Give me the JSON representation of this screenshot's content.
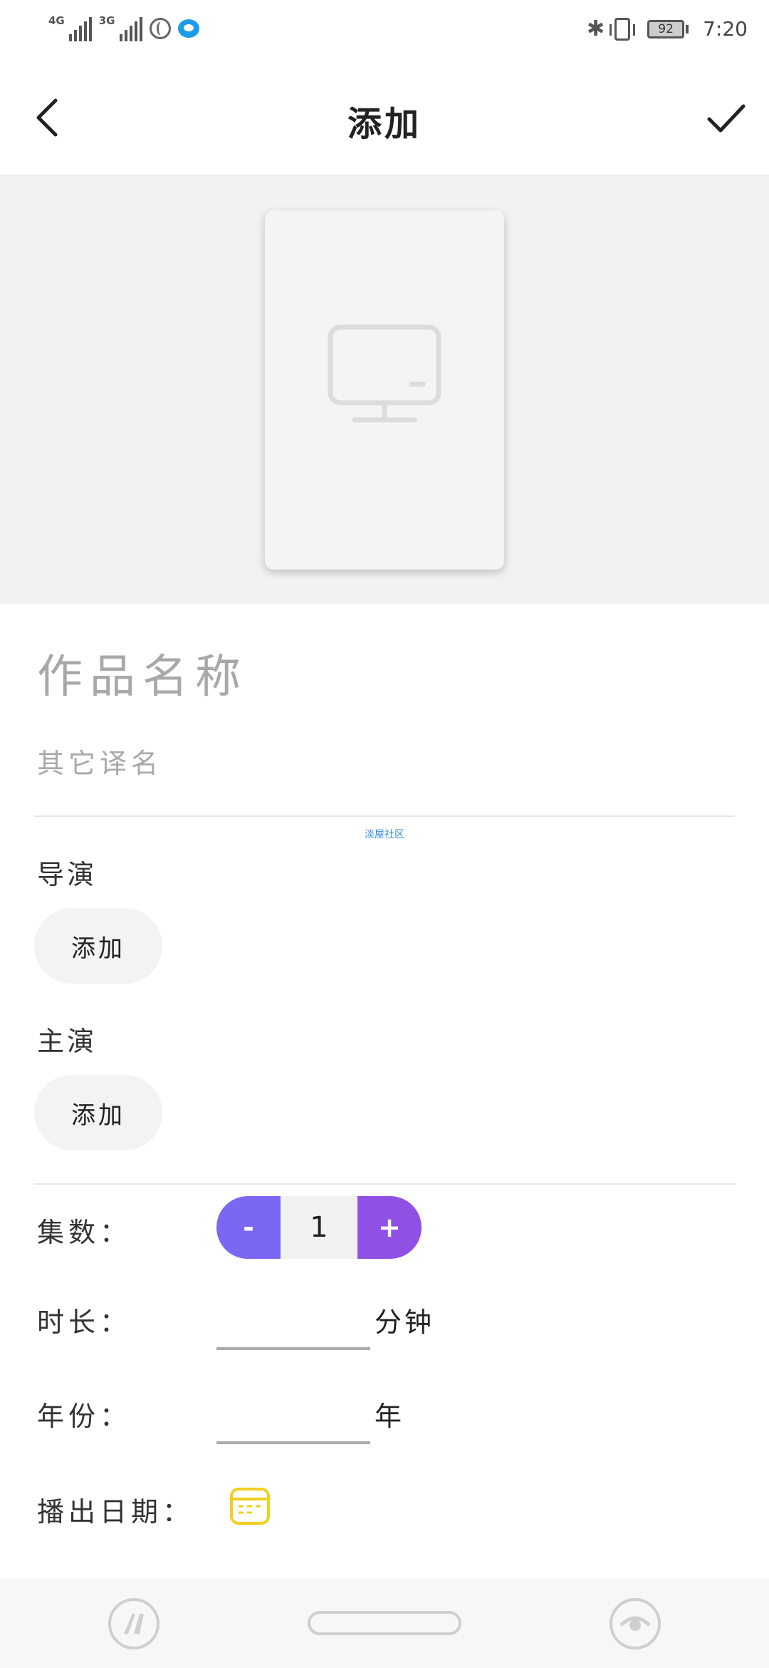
{
  "status_bar": {
    "net1": "4G",
    "net2": "3G",
    "battery": "92",
    "time": "7:20"
  },
  "header": {
    "title": "添加"
  },
  "form": {
    "work_name_placeholder": "作品名称",
    "other_name_placeholder": "其它译名",
    "watermark": "淡屋社区",
    "director_label": "导演",
    "director_add": "添加",
    "cast_label": "主演",
    "cast_add": "添加",
    "episodes_label": "集数：",
    "episodes_minus": "-",
    "episodes_value": "1",
    "episodes_plus": "+",
    "duration_label": "时长：",
    "duration_unit": "分钟",
    "year_label": "年份：",
    "year_unit": "年",
    "air_date_label": "播出日期："
  },
  "icons": {
    "back": "chevron-left-icon",
    "confirm": "checkmark-icon",
    "cover": "monitor-icon",
    "calendar": "calendar-icon"
  },
  "colors": {
    "stepper_minus": "#7a68f2",
    "stepper_plus": "#9150e4",
    "calendar": "#f2cf1f",
    "watermark": "#3b8fdc"
  }
}
